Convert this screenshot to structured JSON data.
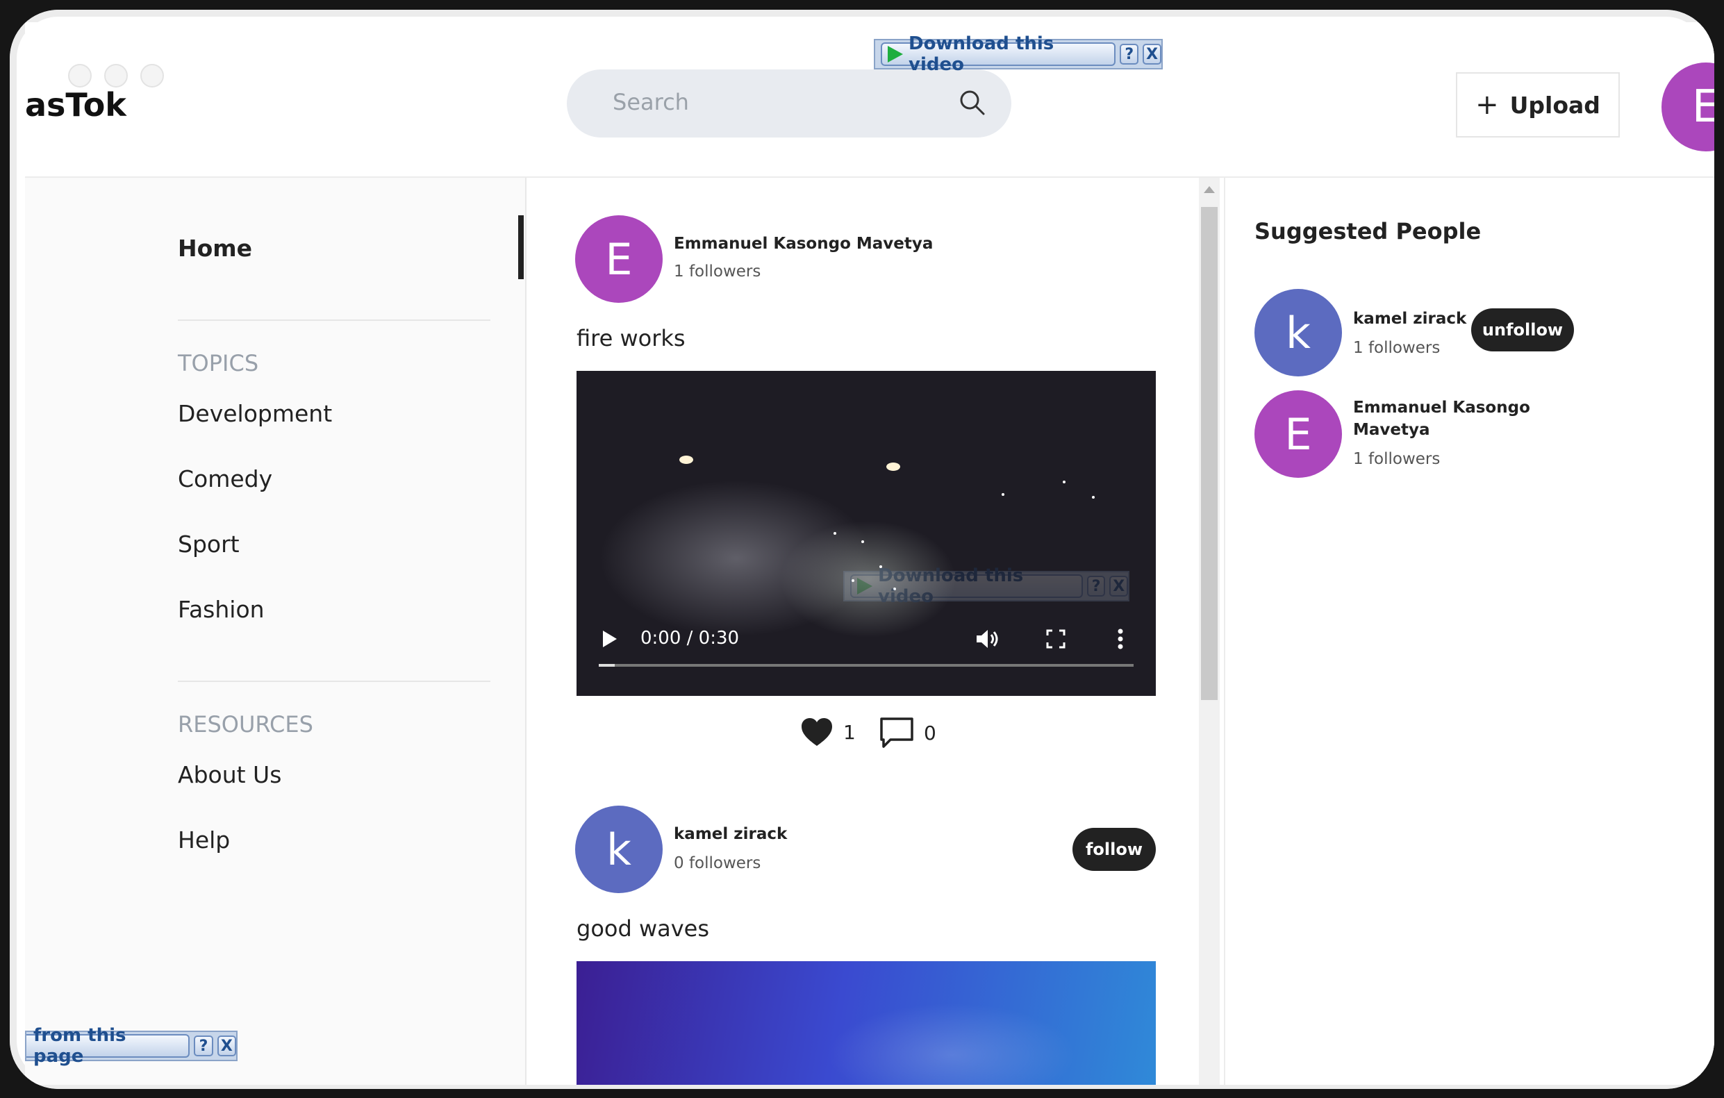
{
  "app": {
    "logo": "asTok",
    "user_initial": "E"
  },
  "search": {
    "placeholder": "Search"
  },
  "header": {
    "upload_label": "Upload"
  },
  "sidebar": {
    "home": "Home",
    "topics_title": "TOPICS",
    "topics": [
      "Development",
      "Comedy",
      "Sport",
      "Fashion"
    ],
    "resources_title": "RESOURCES",
    "resources": [
      "About Us",
      "Help"
    ]
  },
  "feed": {
    "posts": [
      {
        "author": "Emmanuel Kasongo Mavetya",
        "initial": "E",
        "followers": "1 followers",
        "caption": "fire works",
        "time": "0:00 / 0:30",
        "progress": 0.03,
        "likes": "1",
        "comments": "0"
      },
      {
        "author": "kamel zirack",
        "initial": "k",
        "followers": "0 followers",
        "caption": "good waves",
        "follow_label": "follow"
      }
    ]
  },
  "suggested": {
    "title": "Suggested People",
    "people": [
      {
        "name": "kamel zirack",
        "initial": "k",
        "followers": "1 followers",
        "button": "unfollow"
      },
      {
        "name_line1": "Emmanuel Kasongo",
        "name_line2": "Mavetya",
        "initial": "E",
        "followers": "1 followers"
      }
    ]
  },
  "overlays": {
    "download_video": "Download this video",
    "help": "?",
    "close": "X",
    "download_page": "from this page"
  },
  "colors": {
    "purple_avatar": "#ab47bc",
    "blue_avatar": "#5c6bc0",
    "dark_button": "#222222"
  }
}
